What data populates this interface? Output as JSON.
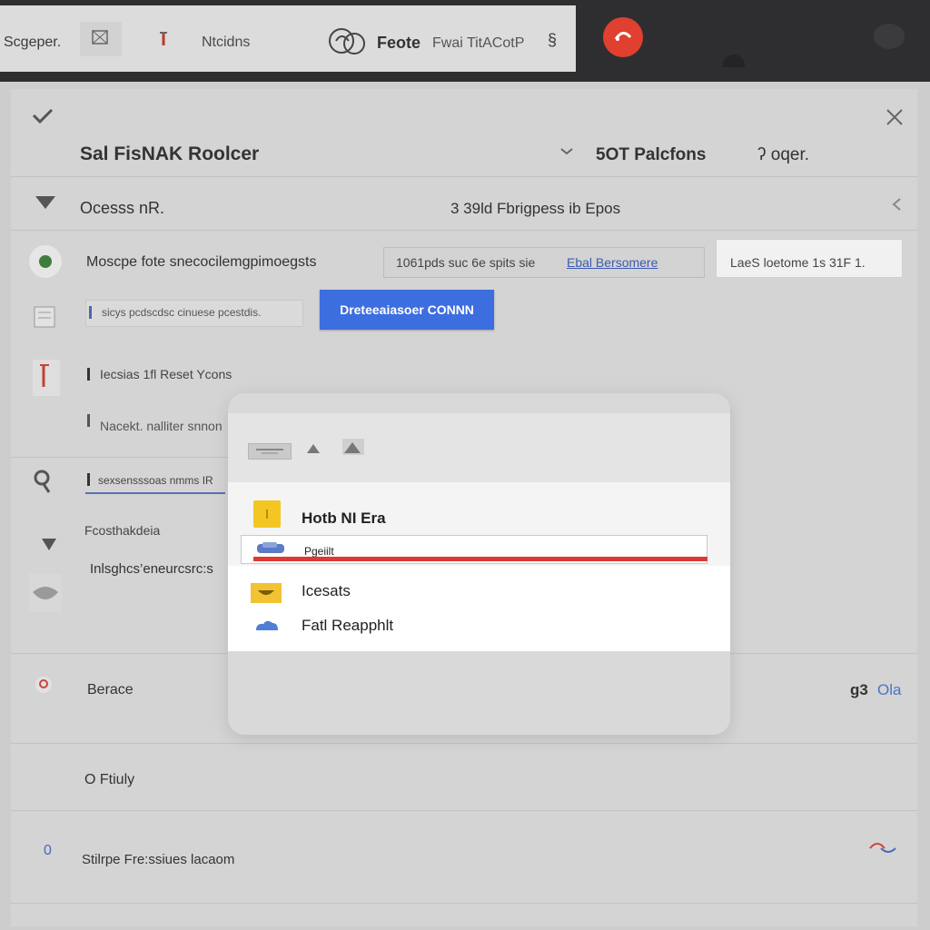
{
  "topbar": {
    "tab1": "Scgeper.",
    "tab3": "Ntcidns",
    "brand_title": "Feote",
    "brand_sub": "Fwai TitACotP",
    "brand_trail": "§"
  },
  "header": {
    "title": "Sal FisNAK  Roolcer",
    "right_a": "5OT Palcfons",
    "right_b": "ʔ oqer."
  },
  "section": {
    "label": "Ocesss nR.",
    "center": "3  39ld Fbrigpess ib  Epos"
  },
  "row1": {
    "label": "Moscpe fote snecocilemgpimoegsts",
    "mid_value": "1061pds suc 6e  spits sie",
    "mid_link": "Ebal Bersomere",
    "right_value": "LaeS loetome 1s 31F  1."
  },
  "row2": {
    "field_text": "sicys pcdscdsc cinuese pcestdis.",
    "button": "Dreteeaiasoer CONNN"
  },
  "row3": {
    "label": "Iecsias  1fl Reset  Ycons",
    "field_text": "Nacekt. nalliter  snnon"
  },
  "row4": {
    "field_text": "sexsensssoas  nmms IR"
  },
  "left_list": {
    "item1": "Fcosthakdeia",
    "item2": "Inlsghcs’eneurcsrc:s"
  },
  "popup": {
    "item1": "Hotb NI Era",
    "item2": "Pgeiilt",
    "item3": "Icesats",
    "item4": "Fatl Reapphlt"
  },
  "rows_bottom": {
    "row1_label": "Berace",
    "row1_right_a": "g3",
    "row1_right_b": "Ola",
    "row2_label": "O Ftiuly",
    "row3_label": "Stilrpe Fre:ssiues lacaom",
    "row3_num": "0"
  },
  "colors": {
    "accent_blue": "#3d6ee0",
    "record_red": "#e0402f",
    "popup_red": "#dd3b32",
    "tile_yellow": "#f3c623"
  }
}
